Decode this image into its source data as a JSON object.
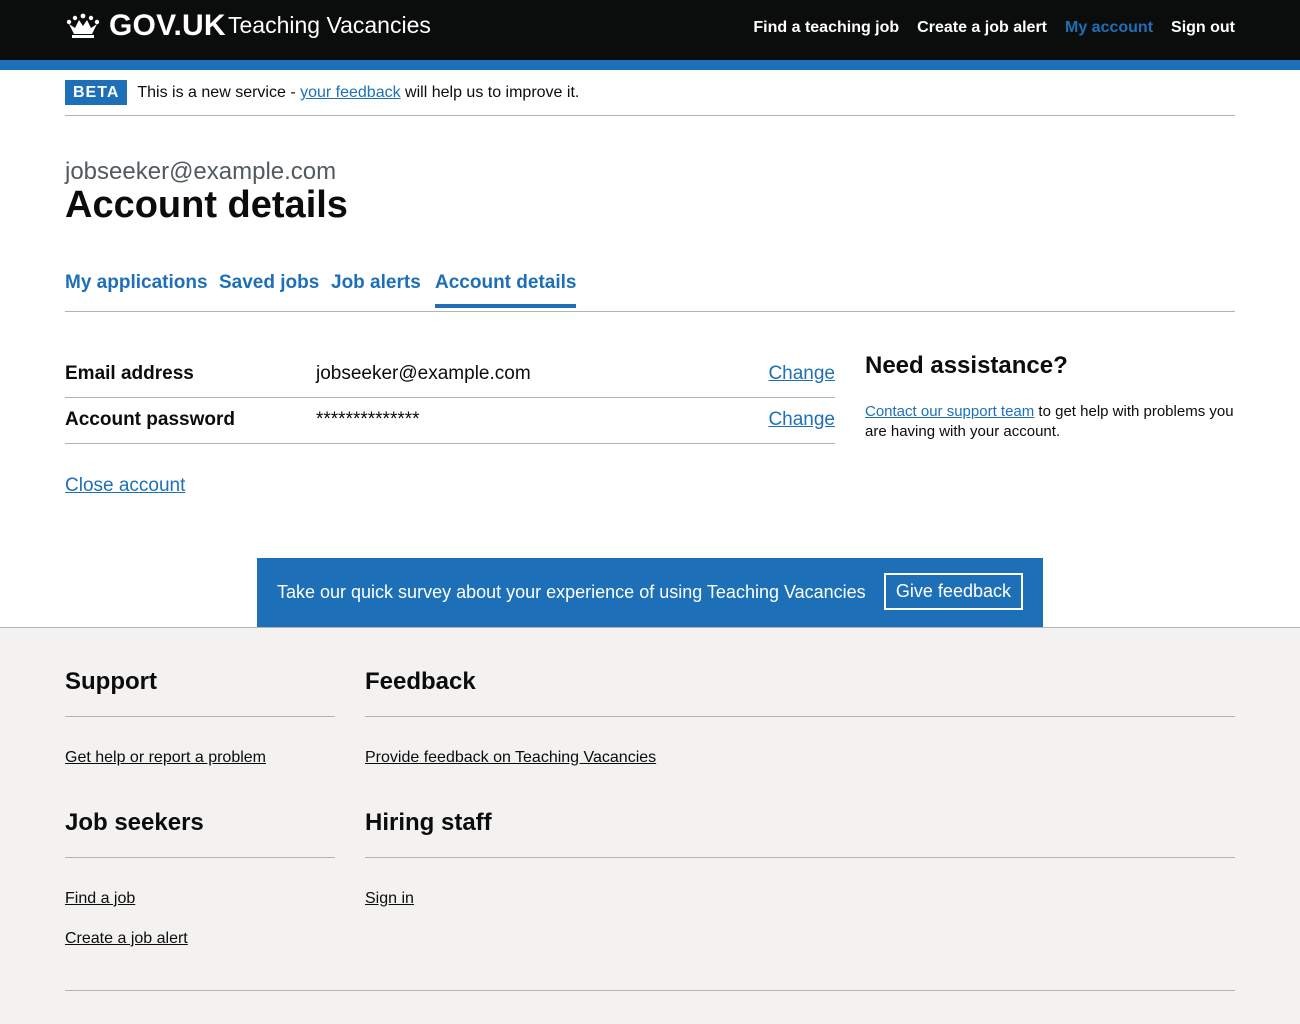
{
  "header": {
    "logo_text": "GOV.UK",
    "service_name": "Teaching Vacancies",
    "nav": [
      {
        "label": "Find a teaching job",
        "active": false
      },
      {
        "label": "Create a job alert",
        "active": false
      },
      {
        "label": "My account",
        "active": true
      },
      {
        "label": "Sign out",
        "active": false
      }
    ]
  },
  "beta": {
    "tag": "BETA",
    "text_before": "This is a new service - ",
    "link": "your feedback",
    "text_after": " will help us to improve it."
  },
  "page": {
    "caption": "jobseeker@example.com",
    "title": "Account details"
  },
  "tabs": [
    {
      "label": "My applications",
      "current": false
    },
    {
      "label": "Saved jobs",
      "current": false
    },
    {
      "label": "Job alerts",
      "current": false
    },
    {
      "label": "Account details",
      "current": true
    }
  ],
  "summary": [
    {
      "key": "Email address",
      "value": "jobseeker@example.com",
      "action": "Change"
    },
    {
      "key": "Account password",
      "value": "**************",
      "action": "Change"
    }
  ],
  "close_account": "Close account",
  "assistance": {
    "title": "Need assistance?",
    "link": "Contact our support team",
    "text": " to get help with problems you are having with your account."
  },
  "feedback_banner": {
    "text": "Take our quick survey about your experience of using Teaching Vacancies",
    "button": "Give feedback"
  },
  "footer": {
    "support": {
      "title": "Support",
      "links": [
        "Get help or report a problem"
      ]
    },
    "feedback": {
      "title": "Feedback",
      "links": [
        "Provide feedback on Teaching Vacancies"
      ]
    },
    "job_seekers": {
      "title": "Job seekers",
      "links": [
        "Find a job",
        "Create a job alert"
      ]
    },
    "hiring_staff": {
      "title": "Hiring staff",
      "links": [
        "Sign in"
      ]
    }
  },
  "colors": {
    "header_bg": "#0b0c0c",
    "brand_blue": "#1d70b8",
    "footer_bg": "#f3f2f1"
  },
  "icons": [
    "crown-icon"
  ]
}
